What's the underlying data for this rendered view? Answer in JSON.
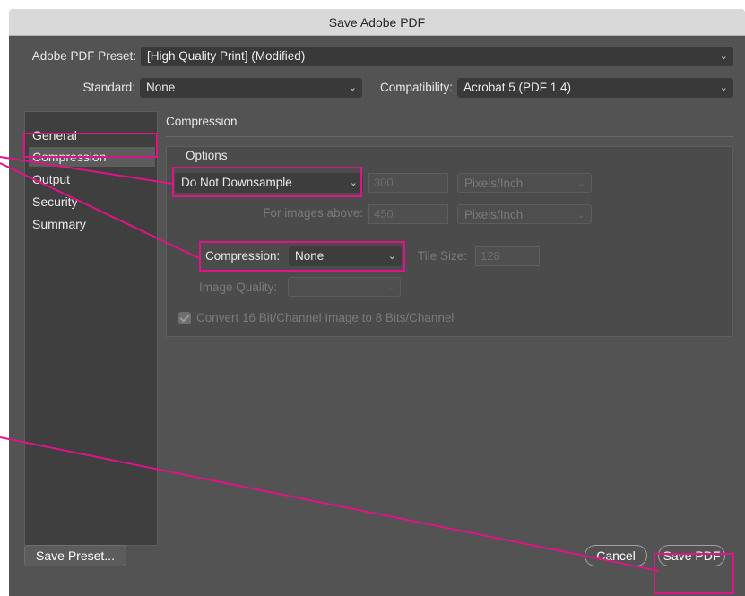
{
  "window": {
    "title": "Save Adobe PDF"
  },
  "preset": {
    "label": "Adobe PDF Preset:",
    "value": "[High Quality Print] (Modified)"
  },
  "standard": {
    "label": "Standard:",
    "value": "None"
  },
  "compatibility": {
    "label": "Compatibility:",
    "value": "Acrobat 5 (PDF 1.4)"
  },
  "sidebar": {
    "items": [
      {
        "label": "General"
      },
      {
        "label": "Compression"
      },
      {
        "label": "Output"
      },
      {
        "label": "Security"
      },
      {
        "label": "Summary"
      }
    ],
    "active": "Compression"
  },
  "section": {
    "title": "Compression"
  },
  "options": {
    "title": "Options",
    "downsample": {
      "value": "Do Not Downsample",
      "ppi": "300",
      "unit": "Pixels/Inch"
    },
    "images_above": {
      "label": "For images above:",
      "ppi": "450",
      "unit": "Pixels/Inch"
    },
    "compression": {
      "label": "Compression:",
      "value": "None"
    },
    "tile_size": {
      "label": "Tile Size:",
      "value": "128"
    },
    "image_quality": {
      "label": "Image Quality:",
      "value": ""
    },
    "convert_16bit": {
      "label": "Convert 16 Bit/Channel Image to 8 Bits/Channel",
      "checked": true
    }
  },
  "buttons": {
    "save_preset": "Save Preset...",
    "cancel": "Cancel",
    "save_pdf": "Save PDF"
  },
  "icons": {
    "dropdown": "chevron-down-icon",
    "checkbox": "checkmark-icon"
  },
  "colors": {
    "highlight": "#e0138a",
    "dialog_bg": "#535353"
  }
}
